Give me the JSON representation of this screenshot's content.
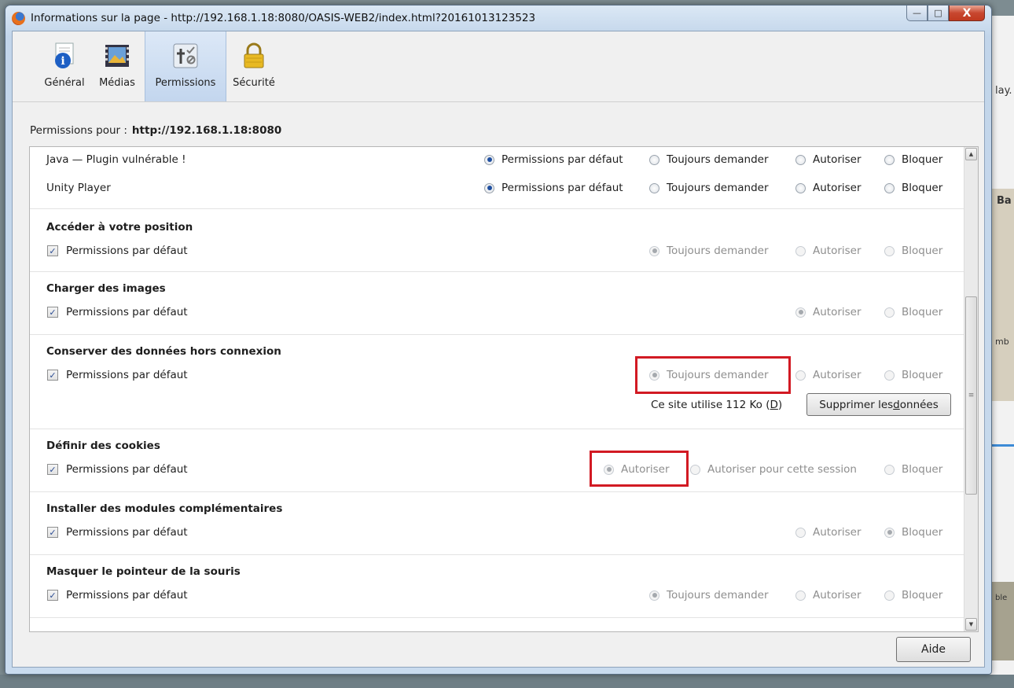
{
  "window": {
    "title": "Informations sur la page - http://192.168.1.18:8080/OASIS-WEB2/index.html?20161013123523",
    "minimize_glyph": "—",
    "maximize_glyph": "□",
    "close_glyph": "X"
  },
  "background": {
    "snip1": "lay.",
    "snip2": "Ba",
    "snip3": "mb",
    "snip4": "ble"
  },
  "tabs": [
    {
      "label": "Général",
      "icon": "info-icon"
    },
    {
      "label": "Médias",
      "icon": "media-icon"
    },
    {
      "label": "Permissions",
      "icon": "permissions-icon",
      "active": true
    },
    {
      "label": "Sécurité",
      "icon": "lock-icon"
    }
  ],
  "permissions_for": {
    "label": "Permissions pour :",
    "host": "http://192.168.1.18:8080"
  },
  "plugins": [
    {
      "name": "Java — Plugin vulnérable !",
      "options": [
        "Permissions par défaut",
        "Toujours demander",
        "Autoriser",
        "Bloquer"
      ]
    },
    {
      "name": "Unity Player",
      "options": [
        "Permissions par défaut",
        "Toujours demander",
        "Autoriser",
        "Bloquer"
      ]
    }
  ],
  "sections": {
    "position": {
      "title": "Accéder à votre position",
      "default_label": "Permissions par défaut",
      "options": [
        "Toujours demander",
        "Autoriser",
        "Bloquer"
      ]
    },
    "images": {
      "title": "Charger des images",
      "default_label": "Permissions par défaut",
      "options": [
        "Autoriser",
        "Bloquer"
      ]
    },
    "offline": {
      "title": "Conserver des données hors connexion",
      "default_label": "Permissions par défaut",
      "options": [
        "Toujours demander",
        "Autoriser",
        "Bloquer"
      ],
      "usage_prefix": "Ce site utilise 112 Ko (",
      "usage_key": "D",
      "usage_suffix": ")",
      "clear_prefix": "Supprimer les ",
      "clear_key": "d",
      "clear_suffix": "onnées"
    },
    "cookies": {
      "title": "Définir des cookies",
      "default_label": "Permissions par défaut",
      "options": [
        "Autoriser",
        "Autoriser pour cette session",
        "Bloquer"
      ]
    },
    "addons": {
      "title": "Installer des modules complémentaires",
      "default_label": "Permissions par défaut",
      "options": [
        "Autoriser",
        "Bloquer"
      ]
    },
    "pointer": {
      "title": "Masquer le pointeur de la souris",
      "default_label": "Permissions par défaut",
      "options": [
        "Toujours demander",
        "Autoriser",
        "Bloquer"
      ]
    }
  },
  "footer": {
    "help_label": "Aide"
  },
  "colors": {
    "highlight": "#d21a23",
    "accent": "#1f4fa0"
  }
}
